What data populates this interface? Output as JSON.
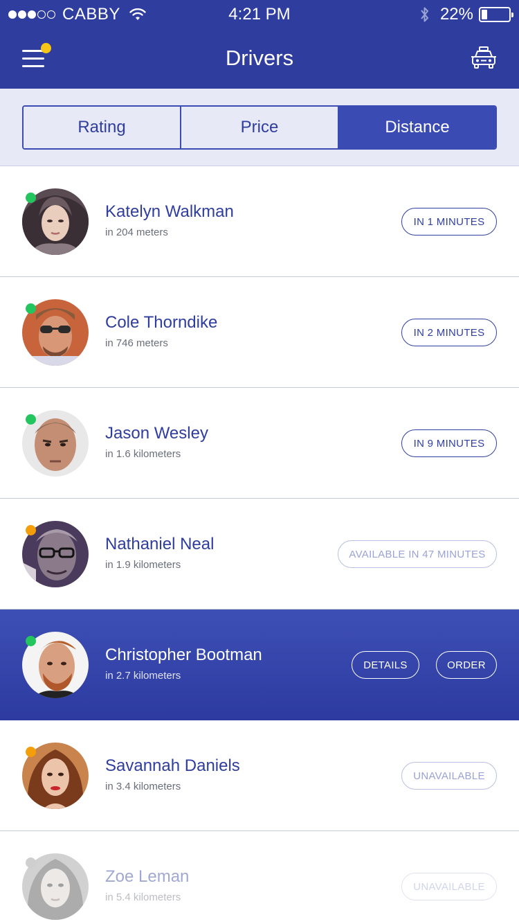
{
  "status_bar": {
    "carrier": "CABBY",
    "time": "4:21 PM",
    "battery": "22%",
    "signal_dots": [
      "full",
      "full",
      "full",
      "empty",
      "empty"
    ]
  },
  "header": {
    "title": "Drivers",
    "menu_icon": "hamburger-menu-icon",
    "right_icon": "taxi-icon",
    "badge_color": "#f5c518"
  },
  "tabs": [
    {
      "label": "Rating",
      "active": false
    },
    {
      "label": "Price",
      "active": false
    },
    {
      "label": "Distance",
      "active": true
    }
  ],
  "drivers": [
    {
      "name": "Katelyn Walkman",
      "distance": "in 204 meters",
      "status": "online",
      "actions": [
        {
          "label": "IN 1 MINUTES",
          "style": "normal"
        }
      ]
    },
    {
      "name": "Cole Thorndike",
      "distance": "in 746 meters",
      "status": "online",
      "actions": [
        {
          "label": "IN 2 MINUTES",
          "style": "normal"
        }
      ]
    },
    {
      "name": "Jason Wesley",
      "distance": "in 1.6 kilometers",
      "status": "online",
      "actions": [
        {
          "label": "IN 9 MINUTES",
          "style": "normal"
        }
      ]
    },
    {
      "name": "Nathaniel Neal",
      "distance": "in 1.9 kilometers",
      "status": "busy",
      "actions": [
        {
          "label": "AVAILABLE IN 47 MINUTES",
          "style": "muted"
        }
      ]
    },
    {
      "name": "Christopher Bootman",
      "distance": "in 2.7 kilometers",
      "status": "online",
      "selected": true,
      "actions": [
        {
          "label": "DETAILS",
          "style": "normal"
        },
        {
          "label": "ORDER",
          "style": "normal"
        }
      ]
    },
    {
      "name": "Savannah Daniels",
      "distance": "in 3.4 kilometers",
      "status": "busy",
      "actions": [
        {
          "label": "UNAVAILABLE",
          "style": "muted"
        }
      ]
    },
    {
      "name": "Zoe Leman",
      "distance": "in 5.4 kilometers",
      "status": "offline",
      "faded": true,
      "actions": [
        {
          "label": "UNAVAILABLE",
          "style": "muted"
        }
      ]
    }
  ],
  "colors": {
    "primary": "#2f3d9e",
    "online": "#22c55e",
    "busy": "#f59e0b",
    "offline": "#cfcfcf"
  }
}
